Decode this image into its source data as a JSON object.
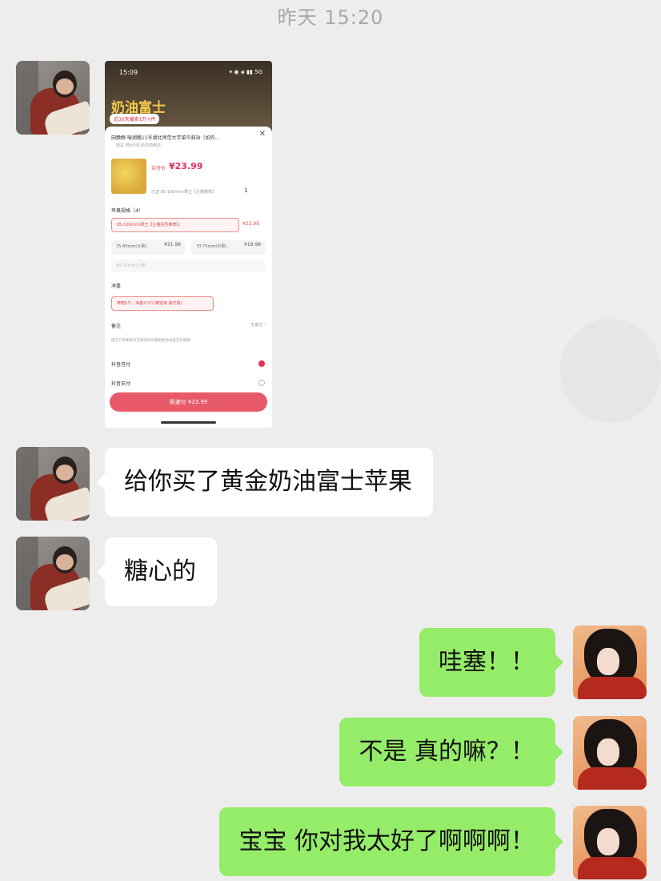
{
  "chat": {
    "timestamp": "昨天 15:20",
    "messages": [
      {
        "side": "left",
        "type": "image"
      },
      {
        "side": "left",
        "text": "给你买了黄金奶油富士苹果"
      },
      {
        "side": "left",
        "text": "糖心的"
      },
      {
        "side": "right",
        "text": "哇塞！！"
      },
      {
        "side": "right",
        "text": "不是 真的嘛？！"
      },
      {
        "side": "right",
        "text": "宝宝 你对我太好了啊啊啊！"
      }
    ]
  },
  "screenshot": {
    "status_time": "15:09",
    "status_icons": "▾ ◉ ◈ ▮▮ 5G",
    "promo_title": "奶油富士",
    "promo_badge": "近30天爆卖1万+件",
    "close_icon": "✕",
    "address": "田静静  喻湖路11号湖北师范大学菜鸟驿站（如的…",
    "address_sub": "现在  预计5月16日前到达",
    "price_label": "实付价",
    "price": "¥23.99",
    "selected_text": "已选 85-100mm(果王【主播推荐】",
    "quantity": "1",
    "spec_title": "苹果规格（4）",
    "options": [
      {
        "label": "85-100mm(果王【主播强烈推荐】)",
        "price": "¥23.99"
      },
      {
        "label": "75-80mm(大果)",
        "price": "¥21.99"
      },
      {
        "label": "70-75mm(中果)",
        "price": "¥18.99"
      },
      {
        "label": "60-70mm(小果)",
        "price": ""
      }
    ],
    "net_weight_title": "净重",
    "net_weight_option": "带箱5斤，净重4.5斤(精选级 最优惠)",
    "note_title": "备注",
    "note_hint": "无备注 ›",
    "agree_text": "提交订单即表示已阅读并同意相关协议及支付规则",
    "pay1": "抖音月付",
    "pay2": "抖音支付",
    "pay_button": "极速付 ¥23.99"
  },
  "colors": {
    "background": "#ededed",
    "left_bubble": "#ffffff",
    "right_bubble": "#95ec69",
    "accent_red": "#e0305a"
  }
}
